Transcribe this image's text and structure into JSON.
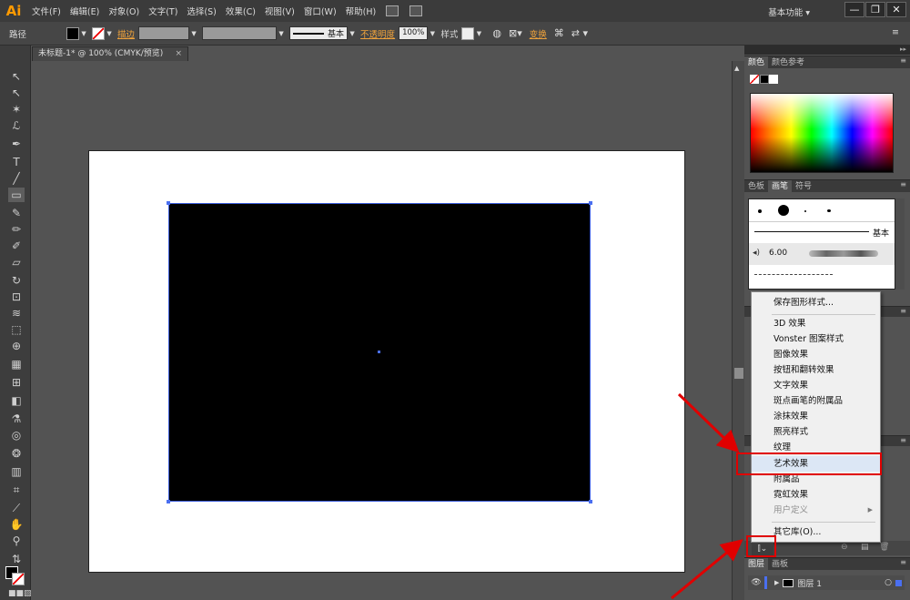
{
  "app": {
    "logo": "Ai"
  },
  "menubar": {
    "items": [
      "文件(F)",
      "编辑(E)",
      "对象(O)",
      "文字(T)",
      "选择(S)",
      "效果(C)",
      "视图(V)",
      "窗口(W)",
      "帮助(H)"
    ],
    "workspace": "基本功能"
  },
  "control": {
    "path_label": "路径",
    "stroke_link": "描边",
    "stroke_style": "基本",
    "opacity_link": "不透明度",
    "opacity_value": "100%",
    "style_label": "样式",
    "transform_link": "变换"
  },
  "document": {
    "tab_title": "未标题-1* @ 100% (CMYK/预览)"
  },
  "panels": {
    "color_tabs": [
      "颜色",
      "颜色参考"
    ],
    "brush_tabs": [
      "色板",
      "画笔",
      "符号"
    ],
    "brush_basic": "基本",
    "brush_size": "6.00",
    "layers_tabs": [
      "图层",
      "画板"
    ],
    "layer_name": "图层 1"
  },
  "style_menu": {
    "items": [
      {
        "label": "保存图形样式...",
        "state": "normal"
      },
      {
        "label": "3D 效果",
        "state": "normal"
      },
      {
        "label": "Vonster 图案样式",
        "state": "normal"
      },
      {
        "label": "图像效果",
        "state": "normal"
      },
      {
        "label": "按钮和翻转效果",
        "state": "normal"
      },
      {
        "label": "文字效果",
        "state": "normal"
      },
      {
        "label": "斑点画笔的附属品",
        "state": "normal"
      },
      {
        "label": "涂抹效果",
        "state": "normal"
      },
      {
        "label": "照亮样式",
        "state": "normal"
      },
      {
        "label": "纹理",
        "state": "normal"
      },
      {
        "label": "艺术效果",
        "state": "highlight"
      },
      {
        "label": "附属品",
        "state": "normal"
      },
      {
        "label": "霓虹效果",
        "state": "normal"
      },
      {
        "label": "用户定义",
        "state": "disabled"
      },
      {
        "label": "其它库(O)...",
        "state": "normal"
      }
    ]
  },
  "colors": {
    "accent_link": "#f0a33b",
    "annotation": "#e00000",
    "selection": "#3a5bd9"
  }
}
